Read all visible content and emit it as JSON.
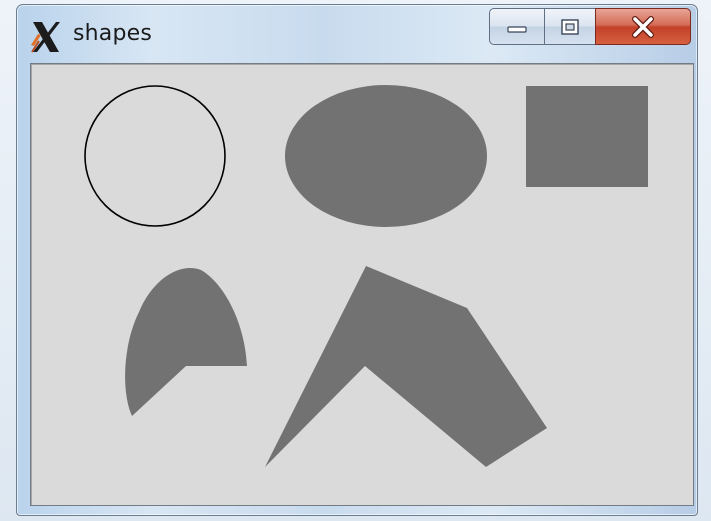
{
  "window": {
    "title": "shapes"
  },
  "icons": {
    "app": "x11-icon",
    "minimize": "minimize-icon",
    "maximize": "maximize-icon",
    "close": "close-icon"
  },
  "colors": {
    "shape_fill": "#727272",
    "outline": "#000000",
    "canvas_bg": "#dadada",
    "close_button": "#c8442c"
  }
}
